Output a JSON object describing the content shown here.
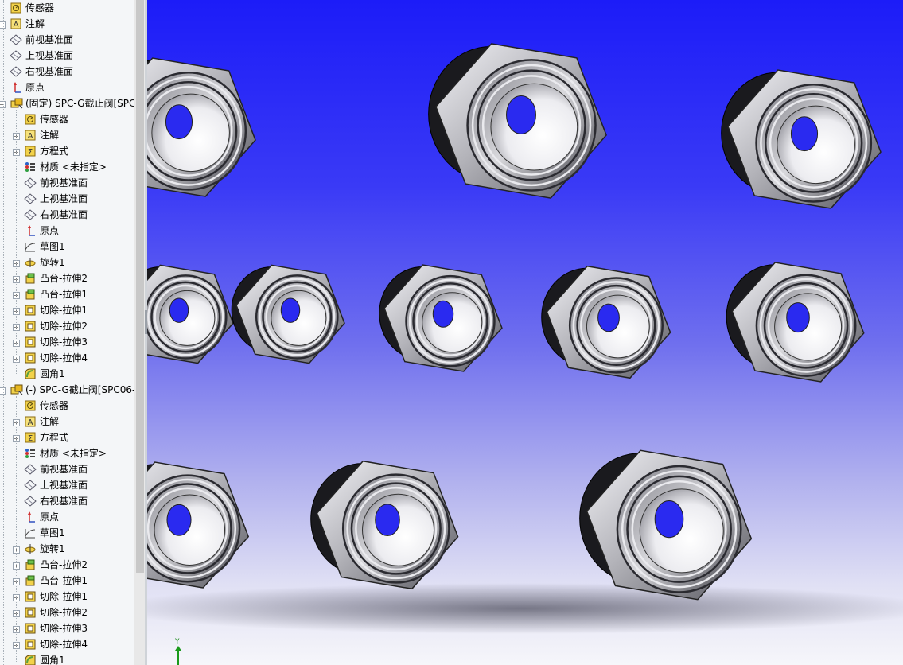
{
  "feature_tree": {
    "top_items": [
      {
        "label": "传感器",
        "icon": "sensor-icon",
        "expander": false
      },
      {
        "label": "注解",
        "icon": "annotation-icon",
        "expander": true
      },
      {
        "label": "前视基准面",
        "icon": "plane-icon",
        "expander": false
      },
      {
        "label": "上视基准面",
        "icon": "plane-icon",
        "expander": false
      },
      {
        "label": "右视基准面",
        "icon": "plane-icon",
        "expander": false
      },
      {
        "label": "原点",
        "icon": "origin-icon",
        "expander": false
      }
    ],
    "components": [
      {
        "label": "(固定) SPC-G截止阀[SPC",
        "items": [
          {
            "label": "传感器",
            "icon": "sensor-icon",
            "expander": false
          },
          {
            "label": "注解",
            "icon": "annotation-icon",
            "expander": true
          },
          {
            "label": "方程式",
            "icon": "equation-icon",
            "expander": true
          },
          {
            "label": "材质 <未指定>",
            "icon": "material-icon",
            "expander": false
          },
          {
            "label": "前视基准面",
            "icon": "plane-icon",
            "expander": false
          },
          {
            "label": "上视基准面",
            "icon": "plane-icon",
            "expander": false
          },
          {
            "label": "右视基准面",
            "icon": "plane-icon",
            "expander": false
          },
          {
            "label": "原点",
            "icon": "origin-icon",
            "expander": false
          },
          {
            "label": "草图1",
            "icon": "sketch-icon",
            "expander": false
          },
          {
            "label": "旋转1",
            "icon": "revolve-icon",
            "expander": true
          },
          {
            "label": "凸台-拉伸2",
            "icon": "boss-extrude-icon",
            "expander": true
          },
          {
            "label": "凸台-拉伸1",
            "icon": "boss-extrude-icon",
            "expander": true
          },
          {
            "label": "切除-拉伸1",
            "icon": "cut-extrude-icon",
            "expander": true
          },
          {
            "label": "切除-拉伸2",
            "icon": "cut-extrude-icon",
            "expander": true
          },
          {
            "label": "切除-拉伸3",
            "icon": "cut-extrude-icon",
            "expander": true
          },
          {
            "label": "切除-拉伸4",
            "icon": "cut-extrude-icon",
            "expander": true
          },
          {
            "label": "圆角1",
            "icon": "fillet-icon",
            "expander": false
          }
        ]
      },
      {
        "label": "(-) SPC-G截止阀[SPC06-",
        "items": [
          {
            "label": "传感器",
            "icon": "sensor-icon",
            "expander": false
          },
          {
            "label": "注解",
            "icon": "annotation-icon",
            "expander": true
          },
          {
            "label": "方程式",
            "icon": "equation-icon",
            "expander": true
          },
          {
            "label": "材质 <未指定>",
            "icon": "material-icon",
            "expander": false
          },
          {
            "label": "前视基准面",
            "icon": "plane-icon",
            "expander": false
          },
          {
            "label": "上视基准面",
            "icon": "plane-icon",
            "expander": false
          },
          {
            "label": "右视基准面",
            "icon": "plane-icon",
            "expander": false
          },
          {
            "label": "原点",
            "icon": "origin-icon",
            "expander": false
          },
          {
            "label": "草图1",
            "icon": "sketch-icon",
            "expander": false
          },
          {
            "label": "旋转1",
            "icon": "revolve-icon",
            "expander": true
          },
          {
            "label": "凸台-拉伸2",
            "icon": "boss-extrude-icon",
            "expander": true
          },
          {
            "label": "凸台-拉伸1",
            "icon": "boss-extrude-icon",
            "expander": true
          },
          {
            "label": "切除-拉伸1",
            "icon": "cut-extrude-icon",
            "expander": true
          },
          {
            "label": "切除-拉伸2",
            "icon": "cut-extrude-icon",
            "expander": true
          },
          {
            "label": "切除-拉伸3",
            "icon": "cut-extrude-icon",
            "expander": true
          },
          {
            "label": "切除-拉伸4",
            "icon": "cut-extrude-icon",
            "expander": true
          },
          {
            "label": "圆角1",
            "icon": "fillet-icon",
            "expander": false
          }
        ]
      }
    ]
  },
  "viewport": {
    "background_top": "#1c1cf8",
    "background_bottom": "#f6f6fa",
    "triad_axis_label": "Y",
    "part_color": "#a8a8ae",
    "count_visible_parts": 10
  }
}
